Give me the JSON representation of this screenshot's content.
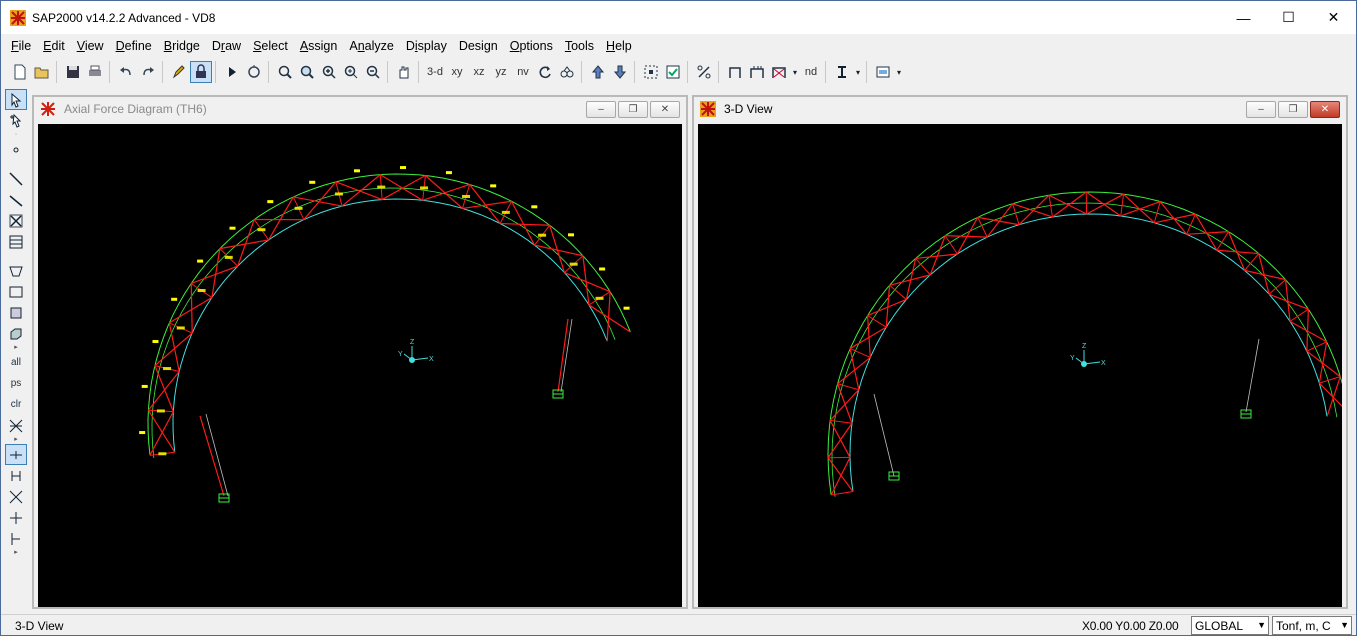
{
  "app": {
    "title": "SAP2000 v14.2.2 Advanced  - VD8"
  },
  "window_controls": {
    "minimize": "—",
    "maximize": "☐",
    "close": "✕"
  },
  "menu": [
    {
      "label": "File",
      "key": "F"
    },
    {
      "label": "Edit",
      "key": "E"
    },
    {
      "label": "View",
      "key": "V"
    },
    {
      "label": "Define",
      "key": "D"
    },
    {
      "label": "Bridge",
      "key": "B"
    },
    {
      "label": "Draw",
      "key": "r"
    },
    {
      "label": "Select",
      "key": "S"
    },
    {
      "label": "Assign",
      "key": "A"
    },
    {
      "label": "Analyze",
      "key": "n"
    },
    {
      "label": "Display",
      "key": "i"
    },
    {
      "label": "Design",
      "key": "g"
    },
    {
      "label": "Options",
      "key": "O"
    },
    {
      "label": "Tools",
      "key": "T"
    },
    {
      "label": "Help",
      "key": "H"
    }
  ],
  "toolbar": {
    "view_3d": "3-d",
    "view_xy": "xy",
    "view_xz": "xz",
    "view_yz": "yz",
    "view_nv": "nv",
    "nd": "nd"
  },
  "leftbar": {
    "all": "all",
    "ps": "ps",
    "clr": "clr"
  },
  "windows": {
    "left": {
      "title": "Axial Force Diagram   (TH6)",
      "active": false
    },
    "right": {
      "title": "3-D View",
      "active": true
    }
  },
  "axes": {
    "z": "Z",
    "x": "X",
    "y": "Y"
  },
  "status": {
    "left_text": "3-D View",
    "coords": "X0.00  Y0.00  Z0.00",
    "coord_system": "GLOBAL",
    "units": "Tonf, m, C"
  },
  "colors": {
    "canvas_bg": "#000000",
    "truss_red": "#ff1a1a",
    "chord_green": "#3cf03c",
    "chord_cyan": "#40e0e0",
    "label_yellow": "#ffff00",
    "support_green": "#3cf03c"
  }
}
